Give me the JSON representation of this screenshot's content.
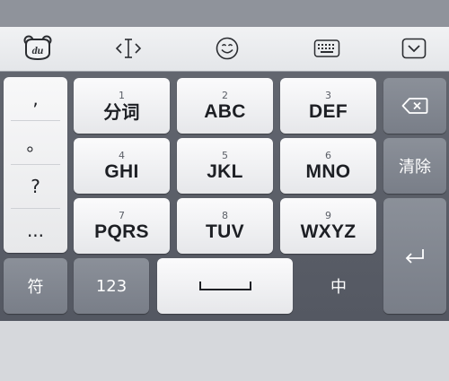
{
  "toolbar": {
    "logo_text": "du",
    "icons": [
      "baidu-bear-logo-icon",
      "cursor-move-icon",
      "emoji-icon",
      "keyboard-icon",
      "collapse-chevron-icon"
    ]
  },
  "punctuation": [
    ",",
    "。",
    "?",
    "..."
  ],
  "keys": {
    "row1": [
      {
        "num": "1",
        "label": "分词"
      },
      {
        "num": "2",
        "label": "ABC"
      },
      {
        "num": "3",
        "label": "DEF"
      }
    ],
    "row2": [
      {
        "num": "4",
        "label": "GHI"
      },
      {
        "num": "5",
        "label": "JKL"
      },
      {
        "num": "6",
        "label": "MNO"
      }
    ],
    "row3": [
      {
        "num": "7",
        "label": "PQRS"
      },
      {
        "num": "8",
        "label": "TUV"
      },
      {
        "num": "9",
        "label": "WXYZ"
      }
    ],
    "clear_label": "清除",
    "symbol_label": "符",
    "numeric_label": "123",
    "lang_label": "中"
  },
  "colors": {
    "board": "#5b5f68",
    "light_key": "#f4f4f6",
    "dark_key": "#838892",
    "toolbar": "#ebecef"
  }
}
